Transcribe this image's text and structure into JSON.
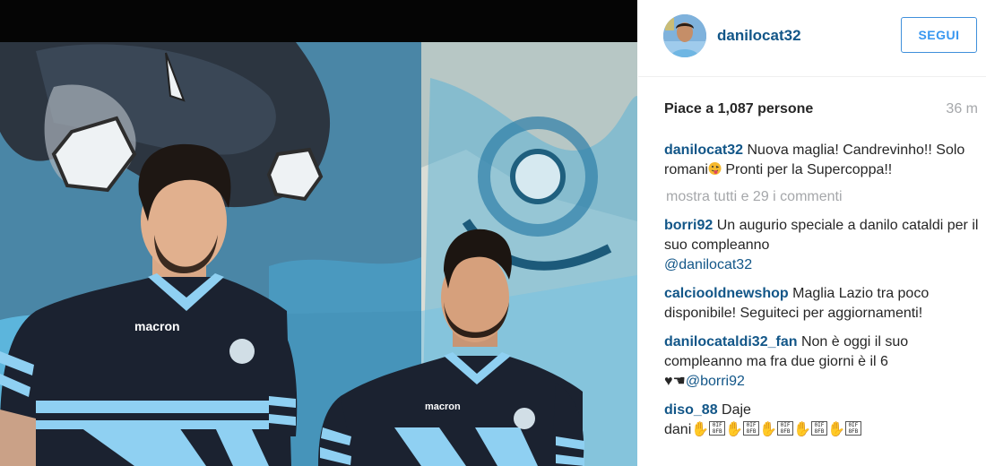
{
  "post": {
    "username": "danilocat32",
    "follow_label": "SEGUI",
    "likes_text": "Piace a 1,087 persone",
    "time": "36 m",
    "view_all_comments": "mostra tutti e 29 i commenti",
    "caption": {
      "user": "danilocat32",
      "text": "Nuova maglia! Candrevinho!! Solo romani",
      "emoji": "face-with-tongue-emoji",
      "text_after": "Pronti per la Supercoppa!!"
    }
  },
  "comments": [
    {
      "user": "borri92",
      "text": "Un augurio speciale a danilo cataldi per il suo compleanno",
      "mention": "@danilocat32"
    },
    {
      "user": "calciooldnewshop",
      "text": "Maglia Lazio tra poco disponibile! Seguiteci per aggiornamenti!"
    },
    {
      "user": "danilocataldi32_fan",
      "text": "Non è oggi il suo compleanno ma fra due giorni è il 6",
      "mention": "@borri92"
    },
    {
      "user": "diso_88",
      "text": "Daje",
      "text_line2": "dani",
      "box_glyph_text": "0IF 8FB"
    }
  ],
  "photo": {
    "shirt_brand": "macron"
  },
  "colors": {
    "username_blue": "#125688",
    "follow_blue": "#3897f0",
    "muted_gray": "#a5a7aa",
    "jersey_navy": "#1b2230",
    "jersey_sky": "#8fd0f2"
  }
}
